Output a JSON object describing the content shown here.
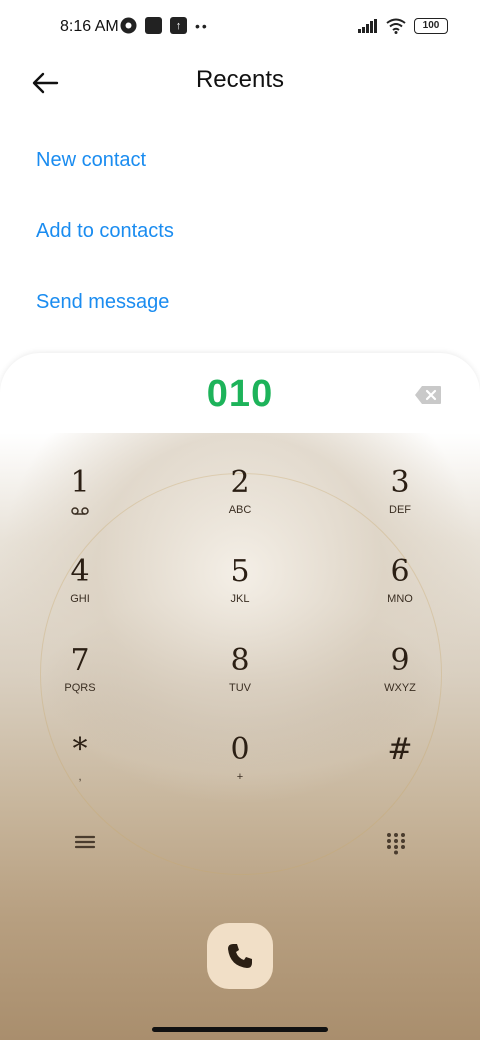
{
  "status_bar": {
    "time": "8:16 AM",
    "battery": "100"
  },
  "header": {
    "title": "Recents",
    "back_icon": "arrow-left-icon"
  },
  "actions": [
    {
      "label": "New contact"
    },
    {
      "label": "Add to contacts"
    },
    {
      "label": "Send message"
    }
  ],
  "dialer": {
    "number": "010",
    "number_color": "#1db35a",
    "keys": [
      {
        "digit": "1",
        "letters": ""
      },
      {
        "digit": "2",
        "letters": "ABC"
      },
      {
        "digit": "3",
        "letters": "DEF"
      },
      {
        "digit": "4",
        "letters": "GHI"
      },
      {
        "digit": "5",
        "letters": "JKL"
      },
      {
        "digit": "6",
        "letters": "MNO"
      },
      {
        "digit": "7",
        "letters": "PQRS"
      },
      {
        "digit": "8",
        "letters": "TUV"
      },
      {
        "digit": "9",
        "letters": "WXYZ"
      },
      {
        "digit": "*",
        "letters": ","
      },
      {
        "digit": "0",
        "letters": "+"
      },
      {
        "digit": "#",
        "letters": ""
      }
    ]
  },
  "colors": {
    "link": "#1a8cf0",
    "call_button": "#f1dfc7"
  }
}
